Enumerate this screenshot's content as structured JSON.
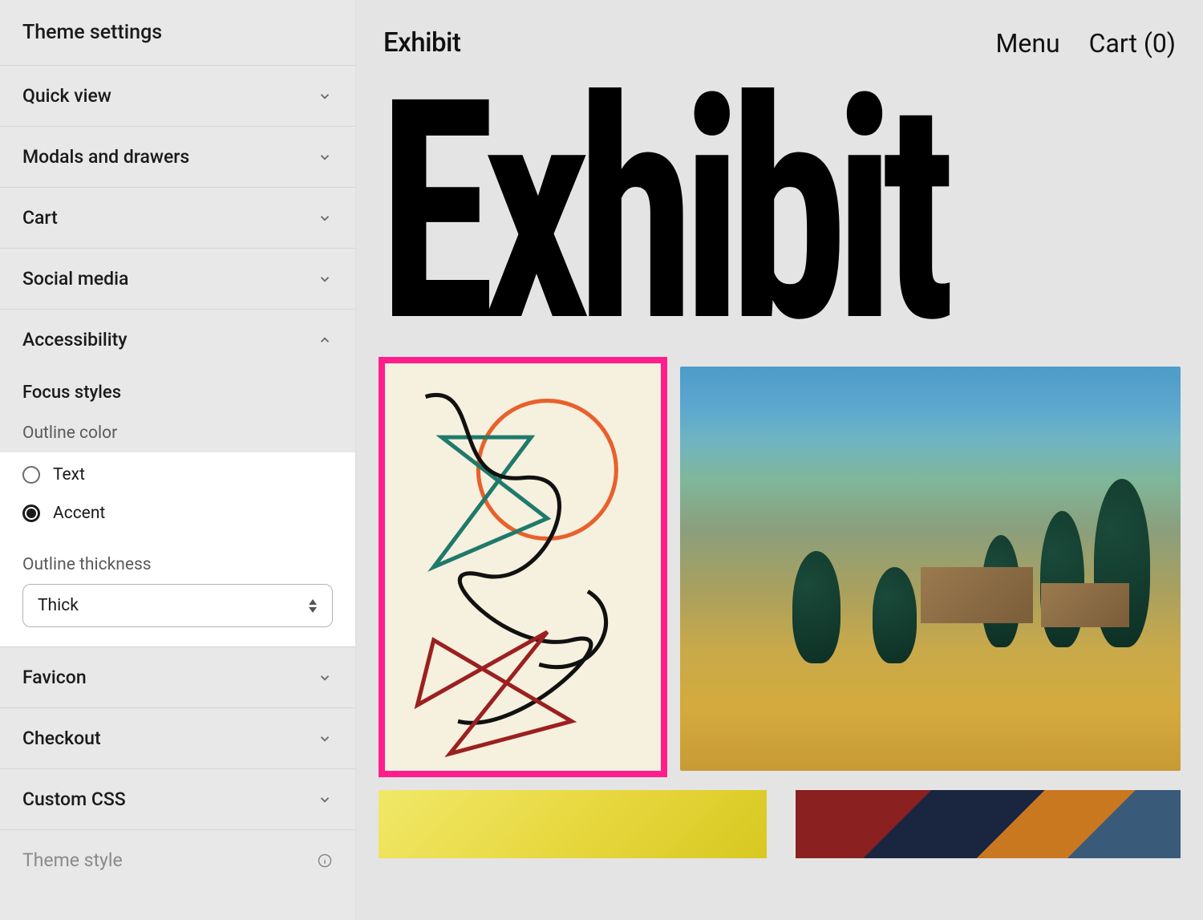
{
  "sidebar": {
    "title": "Theme settings",
    "sections": {
      "quick_view": "Quick view",
      "modals": "Modals and drawers",
      "cart": "Cart",
      "social": "Social media",
      "accessibility": "Accessibility",
      "favicon": "Favicon",
      "checkout": "Checkout",
      "custom_css": "Custom CSS",
      "theme_style": "Theme style"
    },
    "accessibility": {
      "focus_styles_label": "Focus styles",
      "outline_color_label": "Outline color",
      "options": {
        "text": "Text",
        "accent": "Accent"
      },
      "outline_thickness_label": "Outline thickness",
      "thickness_value": "Thick"
    }
  },
  "preview": {
    "brand": "Exhibit",
    "nav": {
      "menu": "Menu",
      "cart": "Cart (0)"
    },
    "hero": "Exhibit",
    "focus_color": "#ff1e8c"
  }
}
